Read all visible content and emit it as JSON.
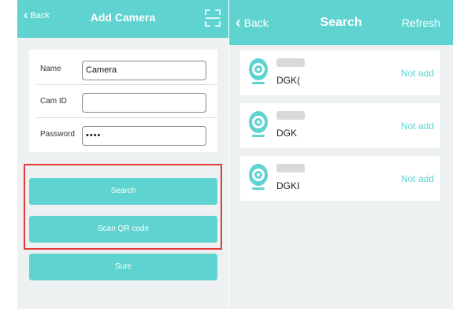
{
  "add_camera": {
    "back_label": "Back",
    "title": "Add Camera",
    "scan_icon": "qr-scan-icon",
    "fields": [
      {
        "label": "Name",
        "value": "Camera"
      },
      {
        "label": "Cam ID",
        "value": ""
      },
      {
        "label": "Password",
        "value": "••••"
      }
    ],
    "search_button": "Search",
    "scan_qr_button": "Scan QR code",
    "sure_button": "Sure",
    "highlight_color": "#e33b3b"
  },
  "search": {
    "back_label": "Back",
    "title": "Search",
    "refresh_label": "Refresh",
    "devices": [
      {
        "id": "DGK(",
        "status": "Not add"
      },
      {
        "id": "DGK",
        "status": "Not add"
      },
      {
        "id": "DGKI",
        "status": "Not add"
      }
    ]
  },
  "colors": {
    "accent": "#5fd3d0",
    "background": "#eef1f2",
    "highlight": "#e33b3b"
  }
}
